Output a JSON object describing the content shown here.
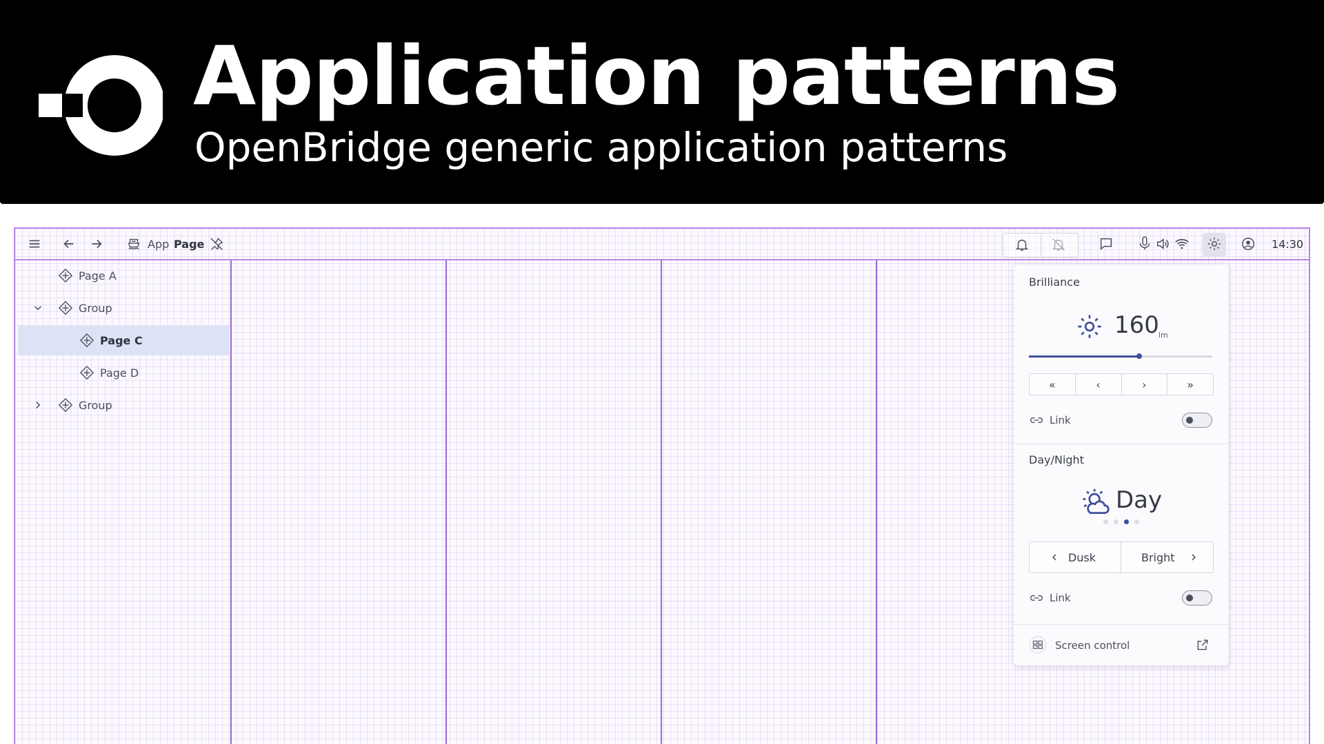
{
  "banner": {
    "title": "Application patterns",
    "subtitle": "OpenBridge generic application patterns",
    "logo_icon": "openbridge-logo"
  },
  "topbar": {
    "menu_icon": "hamburger-menu-icon",
    "app_label": "App",
    "page_label": "Page",
    "time": "14:30",
    "icons": [
      "hamburger-menu-icon",
      "arrow-back-icon",
      "arrow-forward-icon",
      "ship-icon",
      "pin-icon",
      "bell-icon",
      "bell-muted-icon",
      "chat-icon",
      "microphone-icon",
      "speaker-icon",
      "wifi-icon",
      "brilliance-icon",
      "user-icon"
    ]
  },
  "nav": {
    "items": [
      {
        "label": "Page A",
        "level": 0,
        "expandable": false,
        "selected": false
      },
      {
        "label": "Group",
        "level": 0,
        "expandable": true,
        "expanded": true,
        "selected": false
      },
      {
        "label": "Page C",
        "level": 1,
        "expandable": false,
        "selected": true
      },
      {
        "label": "Page D",
        "level": 1,
        "expandable": false,
        "selected": false
      },
      {
        "label": "Group",
        "level": 0,
        "expandable": true,
        "expanded": false,
        "selected": false
      }
    ]
  },
  "brilliance_panel": {
    "brilliance": {
      "title": "Brilliance",
      "value": "160",
      "unit": "lm",
      "slider_fraction": 0.6,
      "stepper": [
        "«",
        "‹",
        "›",
        "»"
      ],
      "link_label": "Link",
      "link_on": false
    },
    "day_night": {
      "title": "Day/Night",
      "value": "Day",
      "palette_count": 4,
      "palette_active_index": 2,
      "prev_label": "Dusk",
      "next_label": "Bright",
      "link_label": "Link",
      "link_on": false
    },
    "screen_control": {
      "label": "Screen control"
    }
  },
  "colors": {
    "accent": "#3d4f9c",
    "grid_line": "#9a66dd",
    "selected_bg": "#dde3f6"
  }
}
